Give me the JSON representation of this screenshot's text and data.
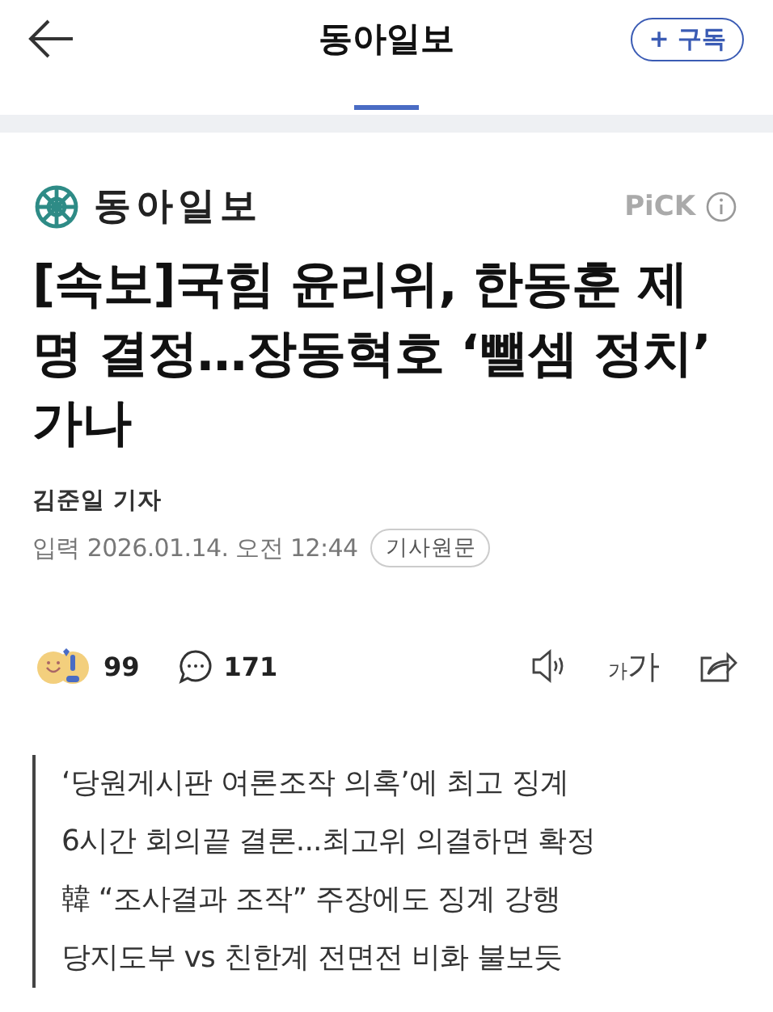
{
  "top_bar": {
    "title": "동아일보",
    "subscribe": "+ 구독"
  },
  "tabs": [
    {
      "selected": true
    }
  ],
  "article": {
    "press": "동아일보",
    "pick": "PiCK",
    "headline": "[속보]국힘 윤리위, 한동훈 제명 결정…장동혁호 ‘뺄셈 정치’ 가나",
    "reporter": "김준일 기자",
    "date": "입력 2026.01.14. 오전 12:44",
    "original_link": "기사원문"
  },
  "reactions": {
    "reaction_count": "99",
    "comment_count": "171",
    "font_size_small": "가",
    "font_size_large": "가"
  },
  "summary": [
    "‘당원게시판 여론조작 의혹’에 최고 징계",
    "6시간 회의끝 결론...최고위 의결하면 확정",
    "韓 “조사결과 조작” 주장에도 징계 강행",
    "당지도부 vs 친한계 전면전 비화 불보듯"
  ]
}
